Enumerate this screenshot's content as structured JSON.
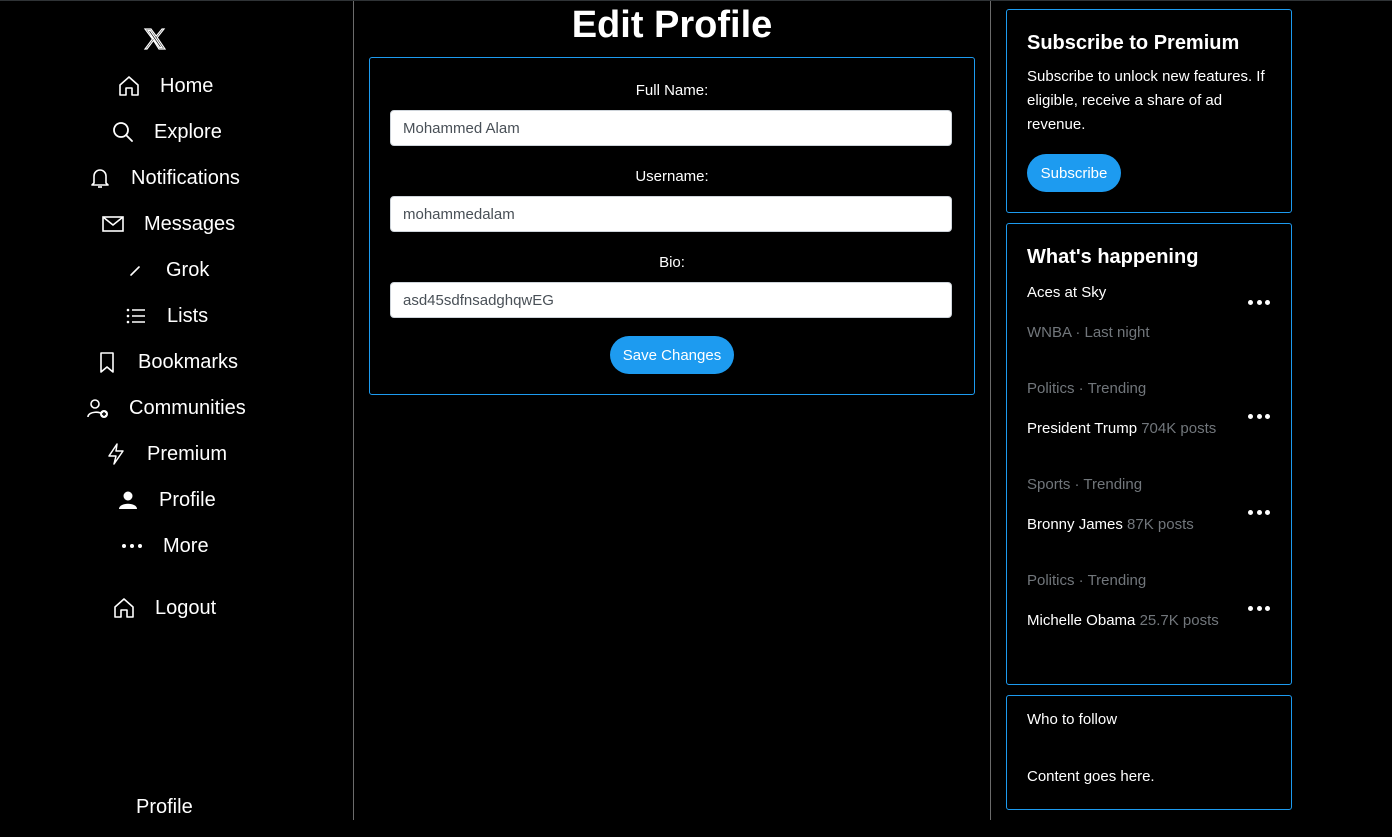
{
  "sidebar": {
    "logo": "x-logo-icon",
    "items": [
      {
        "label": "Home",
        "icon": "home-icon"
      },
      {
        "label": "Explore",
        "icon": "search-icon"
      },
      {
        "label": "Notifications",
        "icon": "bell-icon"
      },
      {
        "label": "Messages",
        "icon": "envelope-icon"
      },
      {
        "label": "Grok",
        "icon": "grok-icon"
      },
      {
        "label": "Lists",
        "icon": "list-icon"
      },
      {
        "label": "Bookmarks",
        "icon": "bookmark-icon"
      },
      {
        "label": "Communities",
        "icon": "communities-icon"
      },
      {
        "label": "Premium",
        "icon": "lightning-icon"
      },
      {
        "label": "Profile",
        "icon": "person-icon"
      },
      {
        "label": "More",
        "icon": "more-dots-icon"
      }
    ],
    "logout": {
      "label": "Logout",
      "icon": "home-icon"
    },
    "footer_label": "Profile"
  },
  "main": {
    "title": "Edit Profile",
    "form": {
      "full_name_label": "Full Name:",
      "full_name_value": "Mohammed Alam",
      "username_label": "Username:",
      "username_value": "mohammedalam",
      "bio_label": "Bio:",
      "bio_value": "asd45sdfnsadghqwEG",
      "save_label": "Save Changes"
    }
  },
  "right": {
    "premium": {
      "title": "Subscribe to Premium",
      "text": "Subscribe to unlock new features. If eligible, receive a share of ad revenue.",
      "button": "Subscribe"
    },
    "happening": {
      "title": "What's happening",
      "trends": [
        {
          "name": "Aces at Sky",
          "meta": "WNBA · Last night"
        },
        {
          "meta": "Politics · Trending",
          "name": "President Trump",
          "count": "704K posts"
        },
        {
          "meta": "Sports · Trending",
          "name": "Bronny James",
          "count": "87K posts"
        },
        {
          "meta": "Politics · Trending",
          "name": "Michelle Obama",
          "count": "25.7K posts"
        }
      ]
    },
    "who_to_follow": {
      "title": "Who to follow",
      "body": "Content goes here."
    }
  },
  "colors": {
    "accent": "#1d9bf0",
    "background": "#000000",
    "muted": "#71767b"
  }
}
